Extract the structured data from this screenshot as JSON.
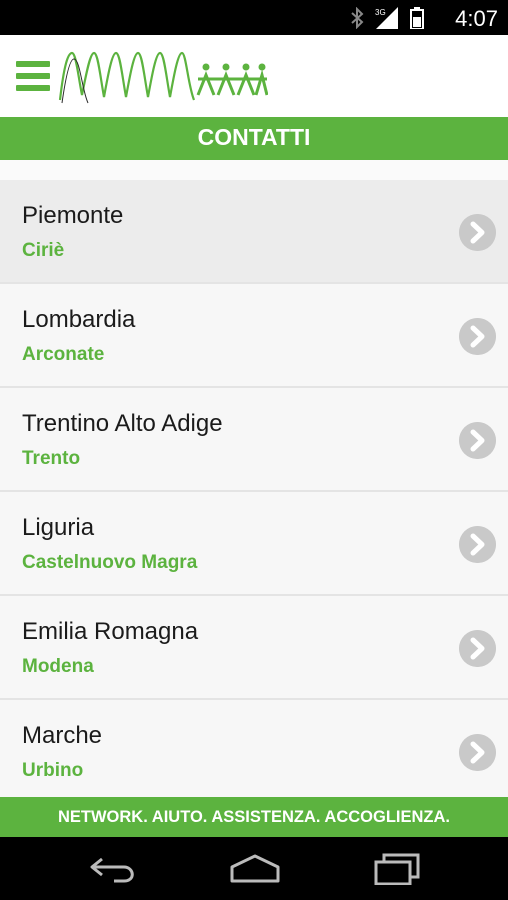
{
  "status_bar": {
    "time": "4:07",
    "network_label": "3G",
    "icons": [
      "bluetooth-icon",
      "signal-icon",
      "battery-icon"
    ]
  },
  "app_bar": {
    "menu_icon": "hamburger-icon",
    "logo_icon": "logo-waves-people"
  },
  "page_title": "CONTATTI",
  "contacts": [
    {
      "region": "Piemonte",
      "city": "Ciriè"
    },
    {
      "region": "Lombardia",
      "city": "Arconate"
    },
    {
      "region": "Trentino Alto Adige",
      "city": "Trento"
    },
    {
      "region": "Liguria",
      "city": "Castelnuovo Magra"
    },
    {
      "region": "Emilia Romagna",
      "city": "Modena"
    },
    {
      "region": "Marche",
      "city": "Urbino"
    }
  ],
  "footer_text": "NETWORK. AIUTO. ASSISTENZA. ACCOGLIENZA.",
  "colors": {
    "accent": "#5cb33f",
    "text": "#1b1b1b",
    "chevron_bg": "#c9c9c9"
  },
  "nav_bar": {
    "icons": [
      "back-icon",
      "home-icon",
      "recent-apps-icon"
    ]
  }
}
